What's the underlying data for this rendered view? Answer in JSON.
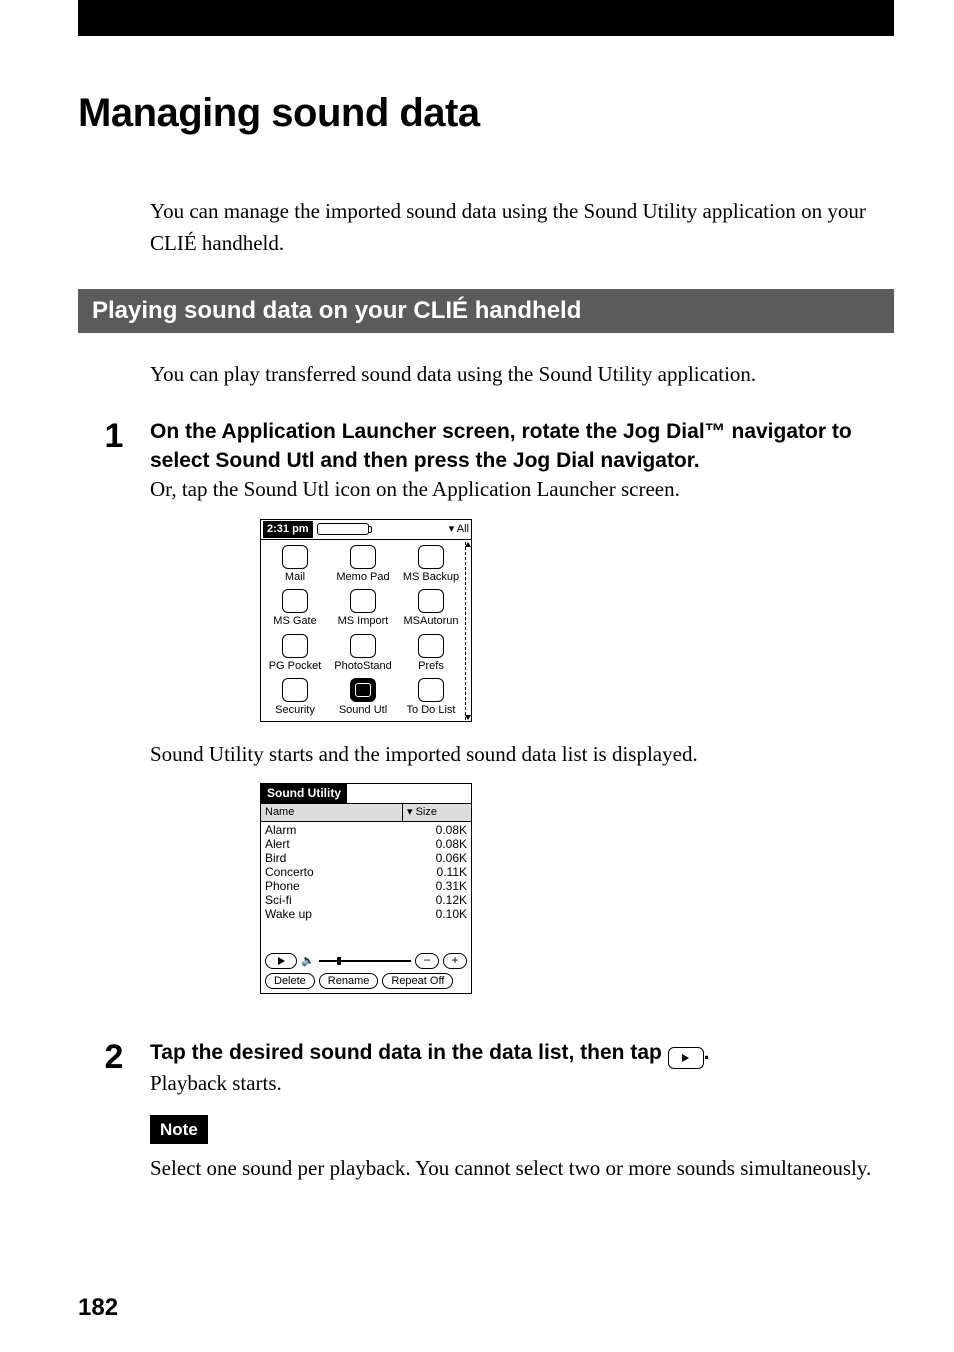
{
  "page": {
    "title": "Managing sound data",
    "intro": "You can manage the imported sound data using the Sound Utility application on your CLIÉ handheld.",
    "number": "182"
  },
  "section": {
    "heading": "Playing sound data on your CLIÉ handheld",
    "intro": "You can play transferred sound data using the Sound Utility application."
  },
  "step1": {
    "num": "1",
    "bold": "On the Application Launcher screen, rotate the Jog Dial™ navigator to select Sound Utl and then press the Jog Dial navigator.",
    "plain": "Or, tap the Sound Utl icon on the Application Launcher screen.",
    "after": "Sound Utility starts and the imported sound data list is displayed."
  },
  "launcher": {
    "time": "2:31 pm",
    "category": "▾ All",
    "apps": [
      {
        "label": "Mail"
      },
      {
        "label": "Memo Pad"
      },
      {
        "label": "MS Backup"
      },
      {
        "label": "MS Gate"
      },
      {
        "label": "MS Import"
      },
      {
        "label": "MSAutorun"
      },
      {
        "label": "PG Pocket"
      },
      {
        "label": "PhotoStand"
      },
      {
        "label": "Prefs"
      },
      {
        "label": "Security"
      },
      {
        "label": "Sound Utl",
        "selected": true
      },
      {
        "label": "To Do List"
      }
    ]
  },
  "sound_utility": {
    "title": "Sound Utility",
    "columns": {
      "name": "Name",
      "size": "▾ Size"
    },
    "rows": [
      {
        "name": "Alarm",
        "size": "0.08K"
      },
      {
        "name": "Alert",
        "size": "0.08K"
      },
      {
        "name": "Bird",
        "size": "0.06K"
      },
      {
        "name": "Concerto",
        "size": "0.11K"
      },
      {
        "name": "Phone",
        "size": "0.31K"
      },
      {
        "name": "Sci-fi",
        "size": "0.12K"
      },
      {
        "name": "Wake up",
        "size": "0.10K"
      }
    ],
    "buttons": {
      "minus": "−",
      "plus": "+",
      "delete": "Delete",
      "rename": "Rename",
      "repeat": "Repeat Off"
    }
  },
  "step2": {
    "num": "2",
    "bold_pre": "Tap the desired sound data in the data list, then tap ",
    "bold_post": ".",
    "plain": "Playback starts."
  },
  "note": {
    "label": "Note",
    "text": "Select one sound per playback. You cannot select two or more sounds simultaneously."
  }
}
